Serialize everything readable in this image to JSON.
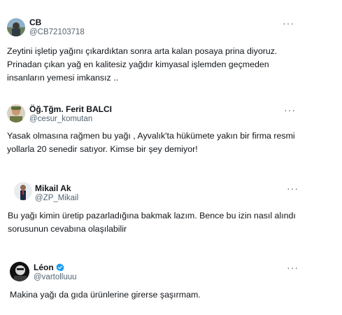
{
  "tweets": [
    {
      "name": "CB",
      "handle": "@CB72103718",
      "text": "Zeytini işletip yağını çıkardıktan sonra arta  kalan posaya prina diyoruz. Prinadan çıkan yağ en kalitesiz yağdır kimyasal işlemden geçmeden insanların yemesi imkansız ..",
      "avatar_icon": "landscape-avatar-icon",
      "verified": false
    },
    {
      "name": "Öğ.Tğm. Ferit BALCI",
      "handle": "@cesur_komutan",
      "text": "Yasak olmasına rağmen bu yağı , Ayvalık'ta hükümete yakın bir firma resmi yollarla 20 senedir satıyor. Kimse bir şey demiyor!",
      "avatar_icon": "soldier-avatar-icon",
      "verified": false
    },
    {
      "name": "Mikail Ak",
      "handle": "@ZP_Mikail",
      "text": "Bu yağı kimin üretip pazarladığına bakmak lazım. Bence bu izin nasıl alındı sorusunun cevabına olaşılabilir",
      "avatar_icon": "person-avatar-icon",
      "verified": false
    },
    {
      "name": "Léon",
      "handle": "@vartolluuu",
      "text": "Makina yağı da gıda ürünlerine girerse şaşırmam.",
      "avatar_icon": "dark-portrait-avatar-icon",
      "verified": true
    }
  ],
  "more_label": "···",
  "colors": {
    "text": "#0f1419",
    "secondary": "#536471",
    "verified": "#1d9bf0"
  }
}
